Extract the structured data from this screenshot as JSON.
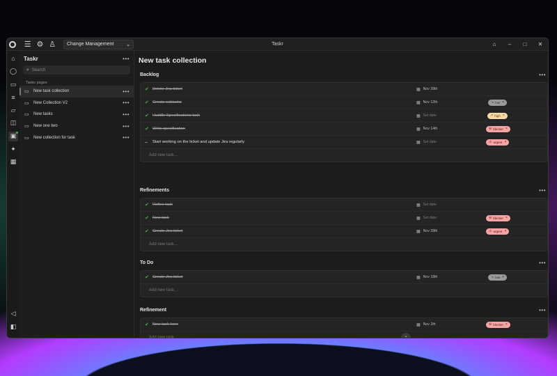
{
  "app": {
    "title": "Taskr",
    "workspace": "Change Management",
    "window_controls": [
      "–",
      "□",
      "✕"
    ]
  },
  "rail": {
    "icons": [
      "home-icon",
      "chat-icon",
      "book-icon",
      "tasks-icon",
      "folder-icon",
      "note-icon",
      "board-icon",
      "sparkle-icon",
      "calendar-icon"
    ],
    "bottom_icons": [
      "megaphone-icon",
      "sidebar-toggle-icon"
    ]
  },
  "sidebar": {
    "title": "Taskr",
    "more": "•••",
    "search_placeholder": "Search",
    "section_label": "Tasks pages",
    "items": [
      {
        "label": "New task collection",
        "active": true,
        "more": "•••"
      },
      {
        "label": "New Collection V2",
        "active": false,
        "more": "•••"
      },
      {
        "label": "New tasks",
        "active": false,
        "more": "•••"
      },
      {
        "label": "New one two",
        "active": false,
        "more": "•••"
      },
      {
        "label": "New collection for task",
        "active": false,
        "more": "•••"
      }
    ]
  },
  "main": {
    "page_title": "New task collection",
    "add_placeholder": "Add new task...",
    "groups": [
      {
        "title": "Backlog",
        "more": "•••",
        "rows": [
          {
            "name": "Delete Jira ticket",
            "done": true,
            "date": "Nov 28th",
            "date_set": true,
            "tag": null
          },
          {
            "name": "Create subtasks",
            "done": true,
            "date": "Nov 12th",
            "date_set": true,
            "tag": {
              "label": "low",
              "kind": "low",
              "x": "×"
            }
          },
          {
            "name": "Huddle Specifications task",
            "done": true,
            "date": "Set date",
            "date_set": false,
            "tag": {
              "label": "high",
              "kind": "high",
              "x": "×"
            }
          },
          {
            "name": "Write specification",
            "done": true,
            "date": "Nov 14th",
            "date_set": true,
            "tag": {
              "label": "blocker",
              "kind": "blocker",
              "x": "×"
            }
          },
          {
            "name": "Start working on the ticket and update Jira regularly",
            "done": false,
            "date": "Set date",
            "date_set": false,
            "tag": {
              "label": "urgent",
              "kind": "urgent",
              "x": "×"
            }
          }
        ]
      },
      {
        "title": "Refinements",
        "more": "•••",
        "rows": [
          {
            "name": "Refine task",
            "done": true,
            "date": "Set date",
            "date_set": false,
            "tag": null
          },
          {
            "name": "New task",
            "done": true,
            "date": "Set date",
            "date_set": false,
            "tag": {
              "label": "blocker",
              "kind": "blocker",
              "x": "×"
            }
          },
          {
            "name": "Create Jira ticket",
            "done": true,
            "date": "Nov 28th",
            "date_set": true,
            "tag": {
              "label": "urgent",
              "kind": "urgent",
              "x": "×"
            }
          }
        ]
      },
      {
        "title": "To Do",
        "more": "•••",
        "rows": [
          {
            "name": "Create Jira ticket",
            "done": true,
            "date": "Nov 18th",
            "date_set": true,
            "tag": {
              "label": "low",
              "kind": "low",
              "x": "×"
            }
          }
        ]
      },
      {
        "title": "Refinement",
        "more": "•••",
        "rows": [
          {
            "name": "New task here",
            "done": true,
            "date": "Nov 2th",
            "date_set": true,
            "tag": {
              "label": "blocker",
              "kind": "blocker",
              "x": "×"
            }
          }
        ]
      }
    ]
  }
}
